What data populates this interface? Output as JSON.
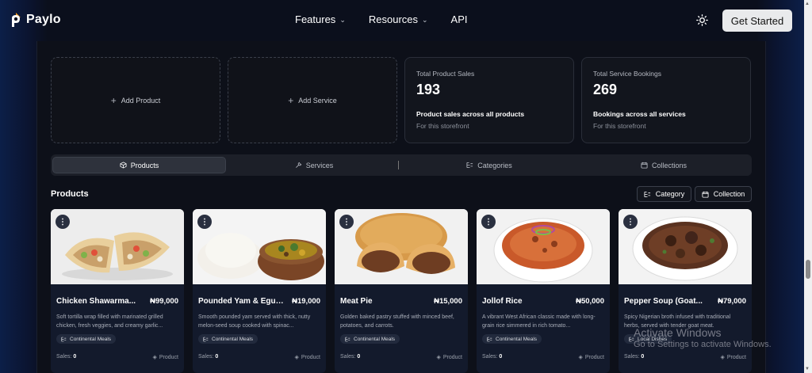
{
  "brand": {
    "name": "Paylo"
  },
  "nav": {
    "items": [
      {
        "label": "Features",
        "has_dropdown": true
      },
      {
        "label": "Resources",
        "has_dropdown": true
      },
      {
        "label": "API",
        "has_dropdown": false
      }
    ],
    "cta_label": "Get Started",
    "theme_icon": "sun-icon"
  },
  "actions": {
    "add_product": "Add Product",
    "add_service": "Add Service"
  },
  "stats": [
    {
      "title": "Total Product Sales",
      "value": "193",
      "subtitle": "Product sales across all products",
      "note": "For this storefront"
    },
    {
      "title": "Total Service Bookings",
      "value": "269",
      "subtitle": "Bookings across all services",
      "note": "For this storefront"
    }
  ],
  "tabs": [
    {
      "label": "Products",
      "icon": "box-icon",
      "active": true
    },
    {
      "label": "Services",
      "icon": "wrench-icon",
      "active": false
    },
    {
      "label": "Categories",
      "icon": "category-icon",
      "active": false
    },
    {
      "label": "Collections",
      "icon": "calendar-icon",
      "active": false
    }
  ],
  "section": {
    "title": "Products",
    "filters": [
      {
        "label": "Category",
        "icon": "category-icon"
      },
      {
        "label": "Collection",
        "icon": "calendar-icon"
      }
    ]
  },
  "products": [
    {
      "name": "Chicken Shawarma...",
      "price": "₦99,000",
      "description": "Soft tortilla wrap filled with marinated grilled chicken, fresh veggies, and creamy garlic...",
      "tag": "Continental Meals",
      "sales_label": "Sales:",
      "sales": "0",
      "type": "Product"
    },
    {
      "name": "Pounded Yam & Egusi...",
      "price": "₦19,000",
      "description": "Smooth pounded yam served with thick, nutty melon-seed soup cooked with spinac...",
      "tag": "Continental Meals",
      "sales_label": "Sales:",
      "sales": "0",
      "type": "Product"
    },
    {
      "name": "Meat Pie",
      "price": "₦15,000",
      "description": "Golden baked pastry stuffed with minced beef, potatoes, and carrots.",
      "tag": "Continental Meals",
      "sales_label": "Sales:",
      "sales": "0",
      "type": "Product"
    },
    {
      "name": "Jollof Rice",
      "price": "₦50,000",
      "description": "A vibrant West African classic made with long-grain rice simmered in rich tomato...",
      "tag": "Continental Meals",
      "sales_label": "Sales:",
      "sales": "0",
      "type": "Product"
    },
    {
      "name": "Pepper Soup (Goat...",
      "price": "₦79,000",
      "description": "Spicy Nigerian broth infused with traditional herbs, served with tender goat meat.",
      "tag": "Local Dishes",
      "sales_label": "Sales:",
      "sales": "0",
      "type": "Product"
    }
  ],
  "watermark": {
    "line1": "Activate Windows",
    "line2": "Go to Settings to activate Windows."
  }
}
